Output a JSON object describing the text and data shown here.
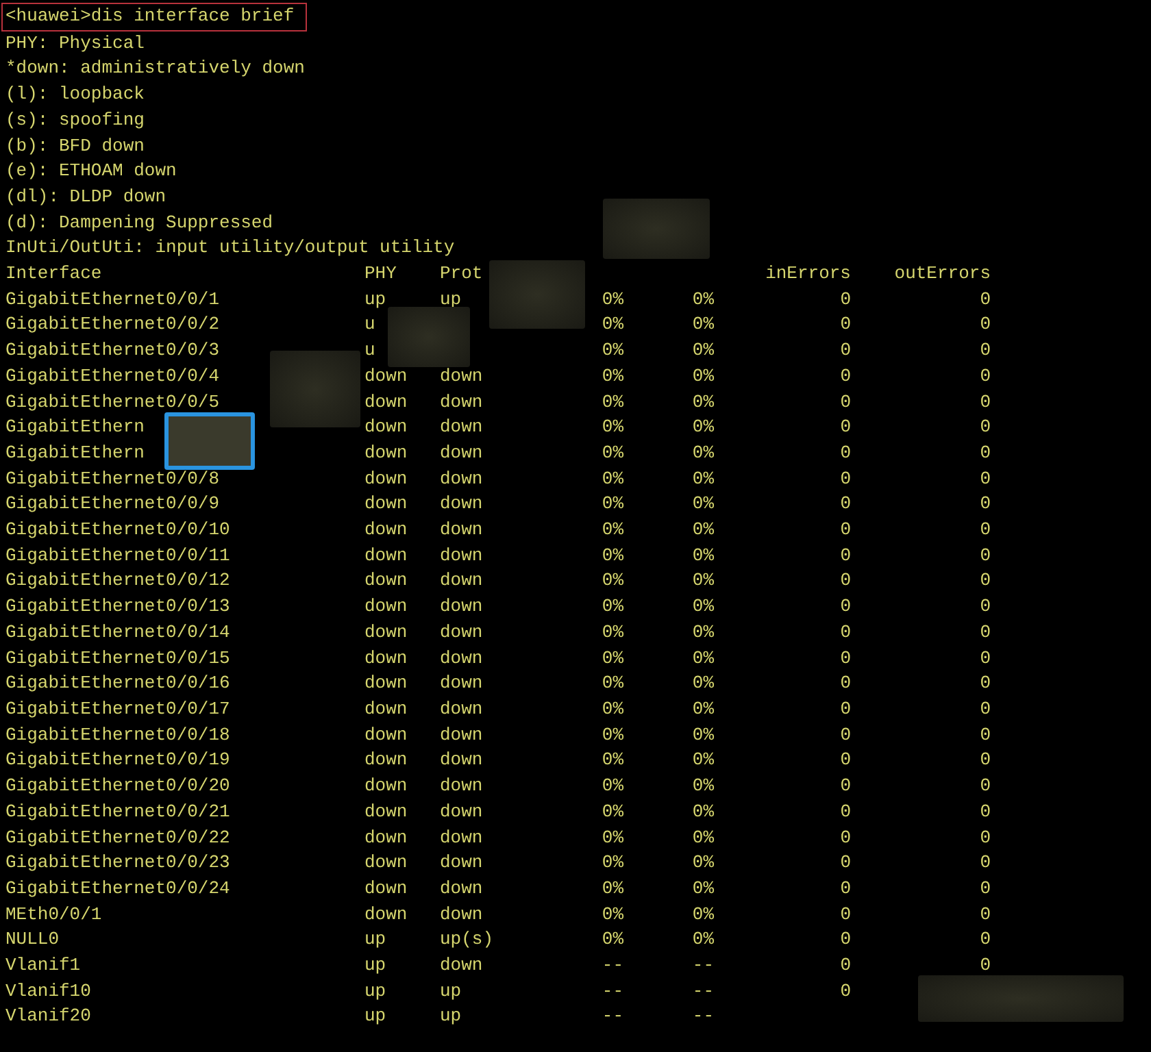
{
  "command": "<huawei>dis interface brief",
  "legend": [
    "PHY: Physical",
    "*down: administratively down",
    "(l): loopback",
    "(s): spoofing",
    "(b): BFD down",
    "(e): ETHOAM down",
    "(dl): DLDP down",
    "(d): Dampening Suppressed",
    "InUti/OutUti: input utility/output utility"
  ],
  "table": {
    "columns": [
      "Interface",
      "PHY",
      "Prot",
      "",
      "",
      "inErrors",
      "outErrors"
    ],
    "rows": [
      [
        "GigabitEthernet0/0/1",
        "up",
        "up",
        "0%",
        "0%",
        "0",
        "0"
      ],
      [
        "GigabitEthernet0/0/2",
        "u",
        "",
        "0%",
        "0%",
        "0",
        "0"
      ],
      [
        "GigabitEthernet0/0/3",
        "u",
        "",
        "0%",
        "0%",
        "0",
        "0"
      ],
      [
        "GigabitEthernet0/0/4",
        "down",
        "down",
        "0%",
        "0%",
        "0",
        "0"
      ],
      [
        "GigabitEthernet0/0/5",
        "down",
        "down",
        "0%",
        "0%",
        "0",
        "0"
      ],
      [
        "GigabitEthern",
        "down",
        "down",
        "0%",
        "0%",
        "0",
        "0"
      ],
      [
        "GigabitEthern",
        "down",
        "down",
        "0%",
        "0%",
        "0",
        "0"
      ],
      [
        "GigabitEthernet0/0/8",
        "down",
        "down",
        "0%",
        "0%",
        "0",
        "0"
      ],
      [
        "GigabitEthernet0/0/9",
        "down",
        "down",
        "0%",
        "0%",
        "0",
        "0"
      ],
      [
        "GigabitEthernet0/0/10",
        "down",
        "down",
        "0%",
        "0%",
        "0",
        "0"
      ],
      [
        "GigabitEthernet0/0/11",
        "down",
        "down",
        "0%",
        "0%",
        "0",
        "0"
      ],
      [
        "GigabitEthernet0/0/12",
        "down",
        "down",
        "0%",
        "0%",
        "0",
        "0"
      ],
      [
        "GigabitEthernet0/0/13",
        "down",
        "down",
        "0%",
        "0%",
        "0",
        "0"
      ],
      [
        "GigabitEthernet0/0/14",
        "down",
        "down",
        "0%",
        "0%",
        "0",
        "0"
      ],
      [
        "GigabitEthernet0/0/15",
        "down",
        "down",
        "0%",
        "0%",
        "0",
        "0"
      ],
      [
        "GigabitEthernet0/0/16",
        "down",
        "down",
        "0%",
        "0%",
        "0",
        "0"
      ],
      [
        "GigabitEthernet0/0/17",
        "down",
        "down",
        "0%",
        "0%",
        "0",
        "0"
      ],
      [
        "GigabitEthernet0/0/18",
        "down",
        "down",
        "0%",
        "0%",
        "0",
        "0"
      ],
      [
        "GigabitEthernet0/0/19",
        "down",
        "down",
        "0%",
        "0%",
        "0",
        "0"
      ],
      [
        "GigabitEthernet0/0/20",
        "down",
        "down",
        "0%",
        "0%",
        "0",
        "0"
      ],
      [
        "GigabitEthernet0/0/21",
        "down",
        "down",
        "0%",
        "0%",
        "0",
        "0"
      ],
      [
        "GigabitEthernet0/0/22",
        "down",
        "down",
        "0%",
        "0%",
        "0",
        "0"
      ],
      [
        "GigabitEthernet0/0/23",
        "down",
        "down",
        "0%",
        "0%",
        "0",
        "0"
      ],
      [
        "GigabitEthernet0/0/24",
        "down",
        "down",
        "0%",
        "0%",
        "0",
        "0"
      ],
      [
        "MEth0/0/1",
        "down",
        "down",
        "0%",
        "0%",
        "0",
        "0"
      ],
      [
        "NULL0",
        "up",
        "up(s)",
        "0%",
        "0%",
        "0",
        "0"
      ],
      [
        "Vlanif1",
        "up",
        "down",
        "--",
        "--",
        "0",
        "0"
      ],
      [
        "Vlanif10",
        "up",
        "up",
        "--",
        "--",
        "0",
        ""
      ],
      [
        "Vlanif20",
        "up",
        "up",
        "--",
        "--",
        "",
        ""
      ]
    ]
  }
}
